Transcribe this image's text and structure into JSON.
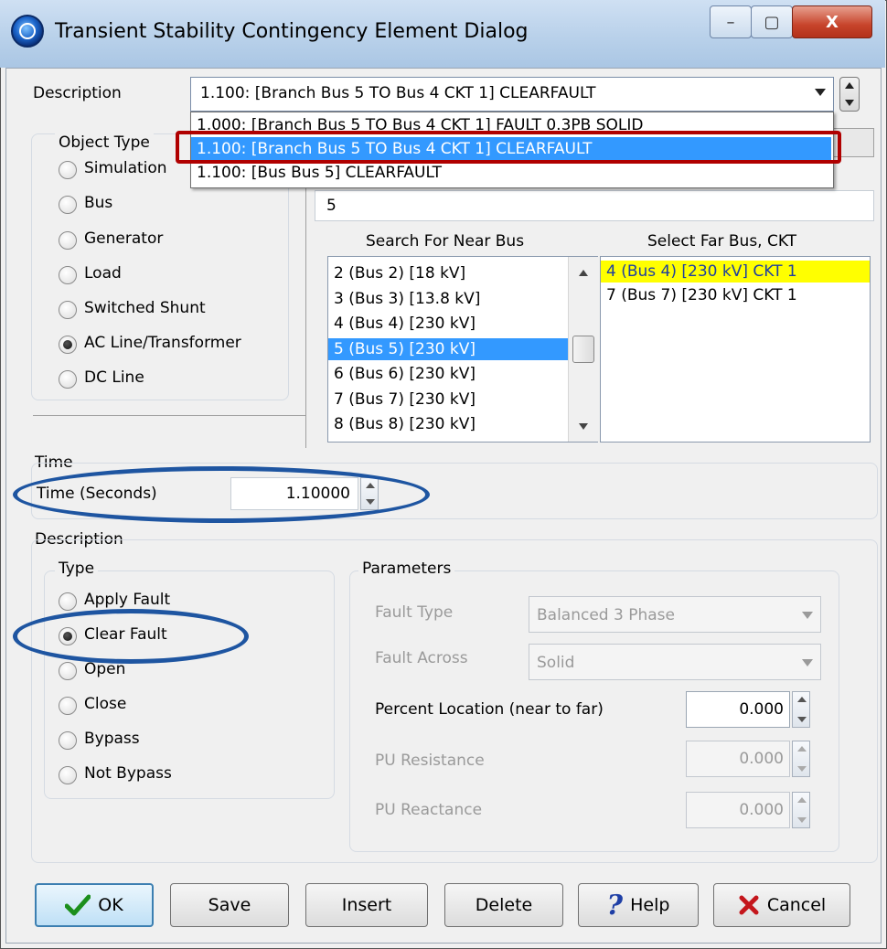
{
  "window": {
    "title": "Transient Stability Contingency Element Dialog",
    "minimize_label": "–",
    "maximize_label": "▢",
    "close_label": "X"
  },
  "description": {
    "label": "Description",
    "selected": "1.100: [Branch Bus 5  TO  Bus 4 CKT 1] CLEARFAULT",
    "dropdown_options": [
      "1.000: [Branch Bus 5  TO  Bus 4 CKT 1] FAULT 0.3PB SOLID",
      "1.100: [Branch Bus 5  TO  Bus 4 CKT 1] CLEARFAULT",
      "1.100: [Bus Bus 5] CLEARFAULT"
    ]
  },
  "object_type": {
    "label": "Object Type",
    "options": [
      "Simulation",
      "Bus",
      "Generator",
      "Load",
      "Switched Shunt",
      "AC Line/Transformer",
      "DC Line"
    ],
    "selected": "AC Line/Transformer"
  },
  "bus_search": {
    "value": "5",
    "near_header": "Search For Near Bus",
    "far_header": "Select Far Bus, CKT",
    "near_list": [
      "2 (Bus 2)  [18 kV]",
      "3 (Bus 3)  [13.8 kV]",
      "4 (Bus 4)  [230 kV]",
      "5 (Bus 5)  [230 kV]",
      "6 (Bus 6)  [230 kV]",
      "7 (Bus 7)  [230 kV]",
      "8 (Bus 8)  [230 kV]"
    ],
    "near_selected_index": 3,
    "far_list": [
      "4 (Bus 4) [230 kV] CKT  1",
      "7 (Bus 7) [230 kV] CKT  1"
    ],
    "far_selected_index": 0
  },
  "time": {
    "group_label": "Time",
    "label": "Time (Seconds)",
    "value": "1.10000"
  },
  "action": {
    "group_label": "Description",
    "type_label": "Type",
    "types": [
      "Apply Fault",
      "Clear Fault",
      "Open",
      "Close",
      "Bypass",
      "Not Bypass"
    ],
    "selected": "Clear Fault"
  },
  "parameters": {
    "label": "Parameters",
    "fault_type_label": "Fault Type",
    "fault_type_value": "Balanced 3 Phase",
    "fault_across_label": "Fault Across",
    "fault_across_value": "Solid",
    "percent_location_label": "Percent Location (near to far)",
    "percent_location_value": "0.000",
    "pu_resistance_label": "PU Resistance",
    "pu_resistance_value": "0.000",
    "pu_reactance_label": "PU Reactance",
    "pu_reactance_value": "0.000"
  },
  "buttons": {
    "ok": "OK",
    "save": "Save",
    "insert": "Insert",
    "delete": "Delete",
    "help": "Help",
    "cancel": "Cancel"
  },
  "colors": {
    "selection": "#3399ff",
    "far_highlight": "#ffff00",
    "annotation_red": "#b00000",
    "annotation_blue": "#1e55a1"
  }
}
